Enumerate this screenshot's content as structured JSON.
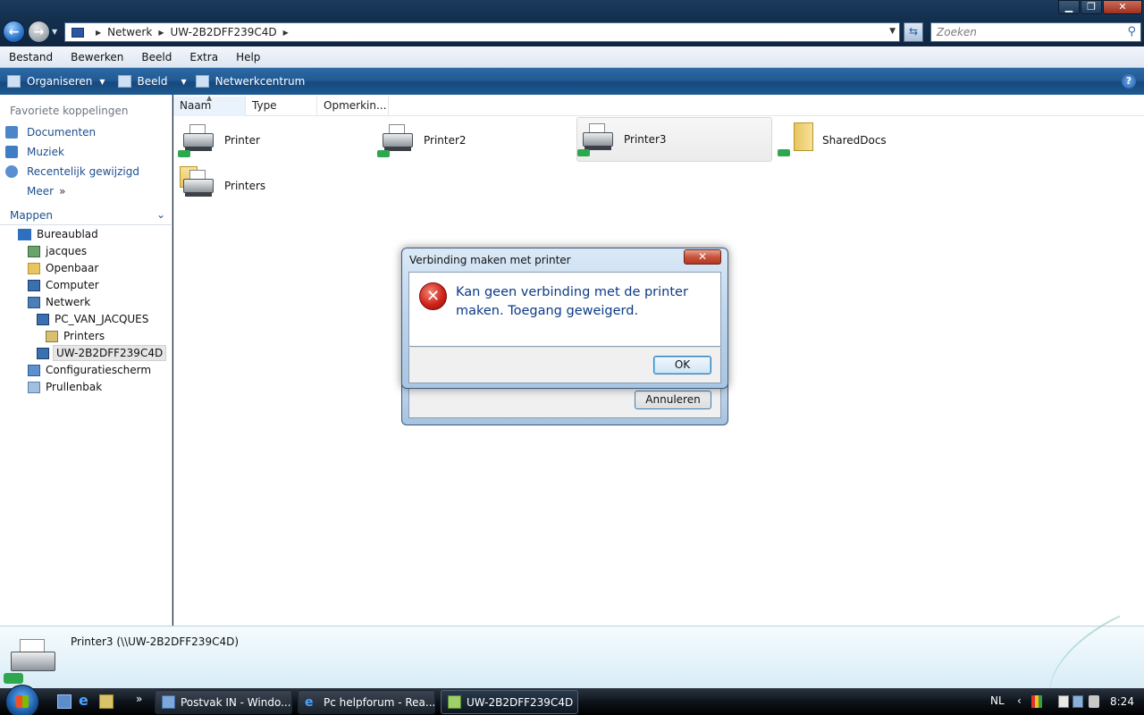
{
  "window": {
    "minimize_glyph": "▁",
    "maximize_glyph": "❐",
    "close_glyph": "✕"
  },
  "address": {
    "crumbs": [
      "Netwerk",
      "UW-2B2DFF239C4D"
    ],
    "search_placeholder": "Zoeken"
  },
  "menu": [
    "Bestand",
    "Bewerken",
    "Beeld",
    "Extra",
    "Help"
  ],
  "commands": {
    "organize": "Organiseren",
    "view": "Beeld",
    "network_center": "Netwerkcentrum",
    "help_glyph": "?"
  },
  "nav": {
    "favorites_heading": "Favoriete koppelingen",
    "favorites": [
      "Documenten",
      "Muziek",
      "Recentelijk gewijzigd",
      "Meer"
    ],
    "more_chevron": "»",
    "folders_heading": "Mappen",
    "tree": [
      "Bureaublad",
      "jacques",
      "Openbaar",
      "Computer",
      "Netwerk",
      "PC_VAN_JACQUES",
      "Printers",
      "UW-2B2DFF239C4D",
      "Configuratiescherm",
      "Prullenbak"
    ]
  },
  "content": {
    "columns": [
      "Naam",
      "Type",
      "Opmerkin..."
    ],
    "items": [
      "Printer",
      "Printer2",
      "Printer3",
      "SharedDocs",
      "Printers"
    ]
  },
  "dialog": {
    "title": "Verbinding maken met printer",
    "message_line1": "Kan geen verbinding met de printer",
    "message_line2": "maken. Toegang geweigerd.",
    "ok": "OK",
    "close_glyph": "✕",
    "error_glyph": "✕",
    "cancel": "Annuleren"
  },
  "details": {
    "name": "Printer3 (\\\\UW-2B2DFF239C4D)"
  },
  "taskbar": {
    "quicklaunch_more": "»",
    "buttons": [
      "Postvak IN - Windo...",
      "Pc helpforum - Rea...",
      "UW-2B2DFF239C4D"
    ],
    "language": "NL",
    "tray_chevron": "‹",
    "clock": "8:24"
  },
  "colors": {
    "titlebar": "#14304f",
    "command_bar": "#215a94",
    "link_text": "#1d4f8e",
    "dialog_message": "#0b3a86",
    "error_red": "#d0231a"
  }
}
